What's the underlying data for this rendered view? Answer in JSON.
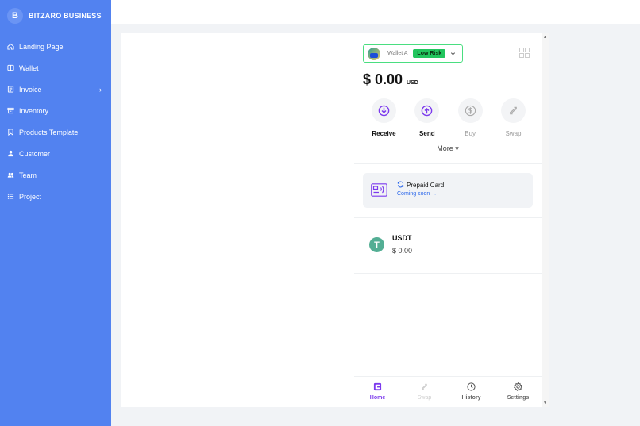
{
  "brand": {
    "logo_letter": "B",
    "name": "BITZARO BUSINESS"
  },
  "sidebar": {
    "items": [
      {
        "label": "Landing Page",
        "icon": "home-icon"
      },
      {
        "label": "Wallet",
        "icon": "wallet-icon"
      },
      {
        "label": "Invoice",
        "icon": "invoice-icon",
        "chevron": "›"
      },
      {
        "label": "Inventory",
        "icon": "archive-icon"
      },
      {
        "label": "Products Template",
        "icon": "bookmark-icon"
      },
      {
        "label": "Customer",
        "icon": "user-icon"
      },
      {
        "label": "Team",
        "icon": "team-icon"
      },
      {
        "label": "Project",
        "icon": "list-icon"
      }
    ]
  },
  "wallet": {
    "name": "Wallet A",
    "risk_badge": "Low Risk",
    "balance_amount": "$ 0.00",
    "balance_currency": "USD",
    "actions": [
      {
        "label": "Receive",
        "icon": "receive-icon",
        "enabled": true
      },
      {
        "label": "Send",
        "icon": "send-icon",
        "enabled": true
      },
      {
        "label": "Buy",
        "icon": "buy-icon",
        "enabled": false
      },
      {
        "label": "Swap",
        "icon": "swap-icon",
        "enabled": false
      }
    ],
    "more_label": "More ▾",
    "prepaid": {
      "title": "Prepaid Card",
      "subtitle": "Coming soon →"
    },
    "tokens": [
      {
        "symbol": "USDT",
        "value": "$ 0.00",
        "icon_letter": "T"
      }
    ]
  },
  "bottom_nav": {
    "tabs": [
      {
        "label": "Home",
        "icon": "home-wallet-icon",
        "state": "active"
      },
      {
        "label": "Swap",
        "icon": "swap-icon",
        "state": "disabled"
      },
      {
        "label": "History",
        "icon": "clock-icon",
        "state": "normal"
      },
      {
        "label": "Settings",
        "icon": "gear-icon",
        "state": "normal"
      }
    ]
  },
  "colors": {
    "sidebar": "#5282f0",
    "accent": "#7c3aed",
    "risk": "#22c55e",
    "link": "#2563eb",
    "token": "#53ae94"
  }
}
